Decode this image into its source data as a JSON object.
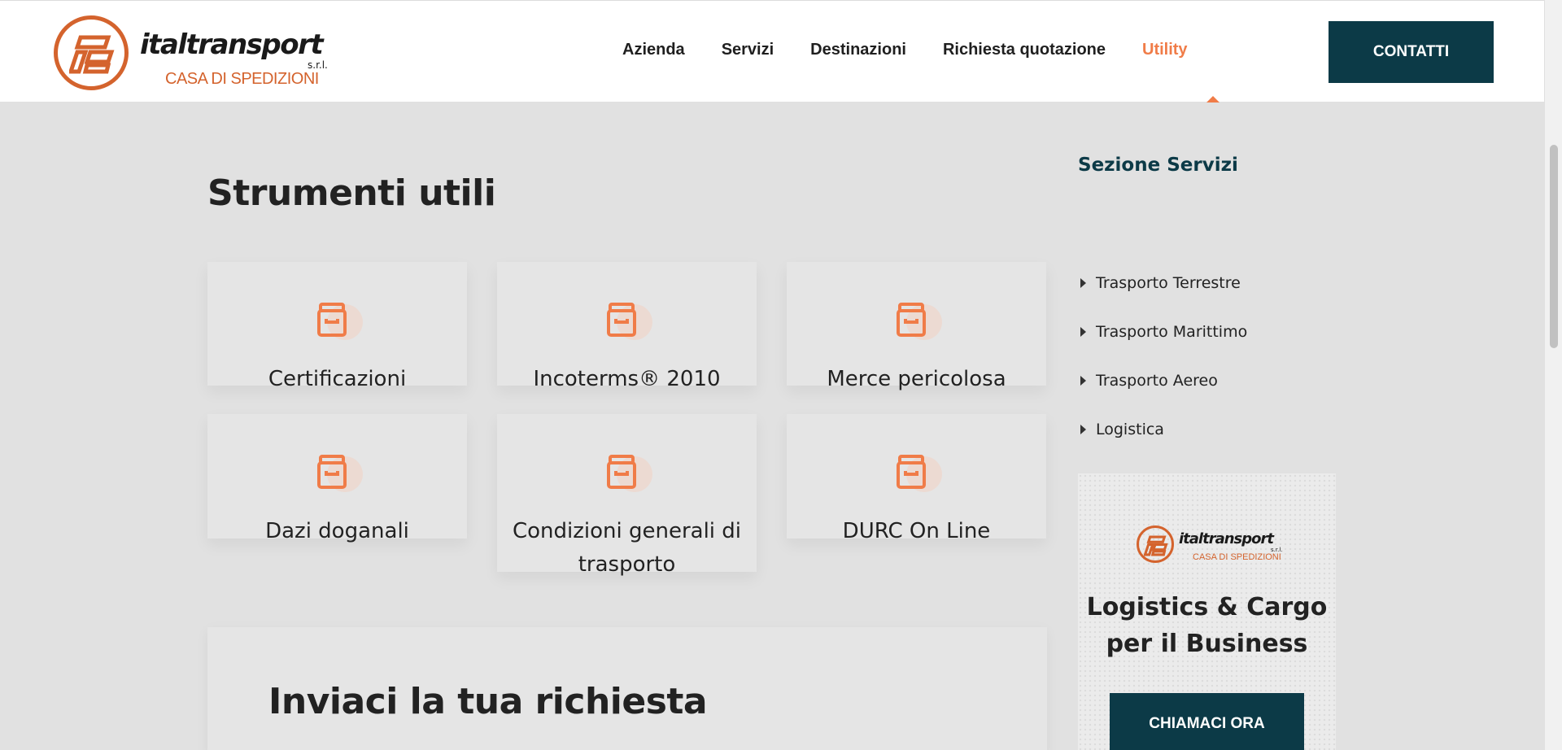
{
  "header": {
    "logo": {
      "name": "italtransport",
      "suffix": "s.r.l.",
      "tagline": "CASA DI SPEDIZIONI"
    },
    "nav": [
      {
        "label": "Azienda"
      },
      {
        "label": "Servizi"
      },
      {
        "label": "Destinazioni"
      },
      {
        "label": "Richiesta quotazione"
      },
      {
        "label": "Utility",
        "active": true
      }
    ],
    "contact_label": "CONTATTI"
  },
  "main": {
    "title": "Strumenti utili",
    "cards": [
      {
        "label": "Certificazioni",
        "icon": "archive-box-icon"
      },
      {
        "label": "Incoterms® 2010",
        "icon": "archive-box-icon"
      },
      {
        "label": "Merce pericolosa",
        "icon": "archive-box-icon"
      },
      {
        "label": "Dazi doganali",
        "icon": "archive-box-icon"
      },
      {
        "label": "Condizioni generali di trasporto",
        "icon": "archive-box-icon"
      },
      {
        "label": "DURC On Line",
        "icon": "archive-box-icon"
      }
    ],
    "request_title": "Inviaci la tua richiesta"
  },
  "sidebar": {
    "title": "Sezione Servizi",
    "items": [
      {
        "label": "Trasporto Terrestre"
      },
      {
        "label": "Trasporto Marittimo"
      },
      {
        "label": "Trasporto Aereo"
      },
      {
        "label": "Logistica"
      }
    ],
    "promo": {
      "logo_name": "italtransport",
      "logo_suffix": "s.r.l.",
      "logo_tagline": "CASA DI SPEDIZIONI",
      "title": "Logistics & Cargo per il Business",
      "button_label": "CHIAMACI ORA"
    }
  },
  "colors": {
    "accent": "#f07c48",
    "brand_dark": "#0c3a47",
    "logo_orange": "#d4632d",
    "background": "#e1e1e1"
  }
}
